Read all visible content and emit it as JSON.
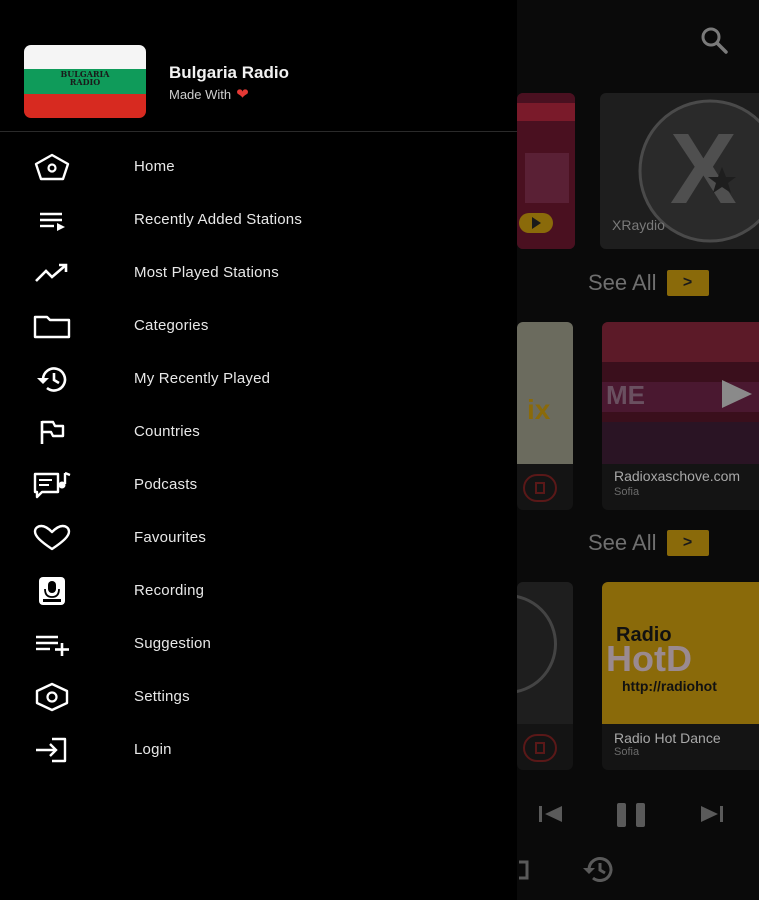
{
  "header": {
    "title": "Bulgaria Radio",
    "subtitle": "Made With",
    "logo_text": "BULGARIA\nRADIO"
  },
  "menu": [
    {
      "label": "Home",
      "icon": "home-icon"
    },
    {
      "label": "Recently Added Stations",
      "icon": "playlist-icon"
    },
    {
      "label": "Most Played Stations",
      "icon": "trending-icon"
    },
    {
      "label": "Categories",
      "icon": "folder-icon"
    },
    {
      "label": "My Recently Played",
      "icon": "history-icon"
    },
    {
      "label": "Countries",
      "icon": "flag-icon"
    },
    {
      "label": "Podcasts",
      "icon": "podcast-icon"
    },
    {
      "label": "Favourites",
      "icon": "heart-icon"
    },
    {
      "label": "Recording",
      "icon": "mic-icon"
    },
    {
      "label": "Suggestion",
      "icon": "playlist-add-icon"
    },
    {
      "label": "Settings",
      "icon": "settings-icon"
    },
    {
      "label": "Login",
      "icon": "login-icon"
    }
  ],
  "background": {
    "see_all": "See All",
    "stations": [
      {
        "name": "XRaydio",
        "city": ""
      },
      {
        "name": "Radioxaschove.com",
        "city": "Sofia"
      },
      {
        "name": "Radio Hot Dance",
        "city": "Sofia"
      }
    ],
    "hotdance_logo": "Radio",
    "hotdance_big": "HotD",
    "hotdance_url": "http://radiohot",
    "mix_text": "ix"
  },
  "colors": {
    "accent": "#8a6a0a",
    "heart": "#e53935",
    "flag_white": "#f5f5f5",
    "flag_green": "#0f9b5a",
    "flag_red": "#d72a20"
  }
}
